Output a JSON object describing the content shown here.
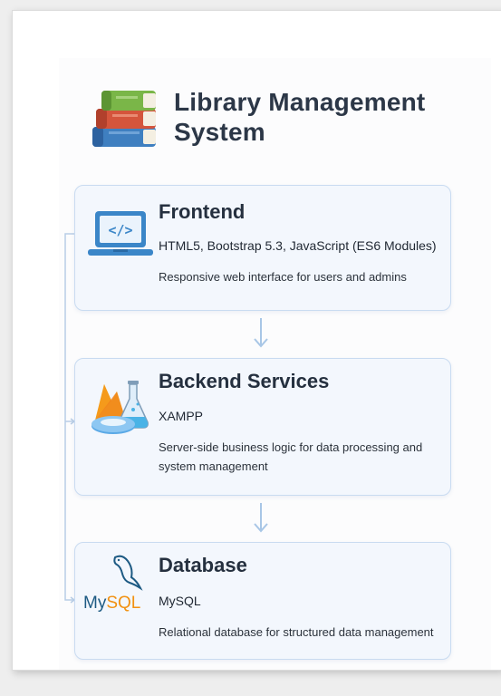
{
  "header": {
    "title_line1": "Library Management",
    "title_line2": "System",
    "icon": "books-stack-icon"
  },
  "layers": [
    {
      "title": "Frontend",
      "tech": "HTML5, Bootstrap 5.3, JavaScript (ES6 Modules)",
      "description": "Responsive web interface for users and admins",
      "icon": "laptop-code-icon"
    },
    {
      "title": "Backend Services",
      "tech": "XAMPP",
      "description": "Server-side business logic for data processing and system management",
      "icon": "firebase-flask-icon"
    },
    {
      "title": "Database",
      "tech": "MySQL",
      "description": "Relational database for structured data management",
      "icon": "mysql-logo-icon",
      "logo_text_a": "My",
      "logo_text_b": "SQL"
    }
  ],
  "colors": {
    "card_bg": "#f3f7fd",
    "card_border": "#c9dbf1",
    "arrow": "#a8c6e6",
    "title": "#2c3747"
  }
}
